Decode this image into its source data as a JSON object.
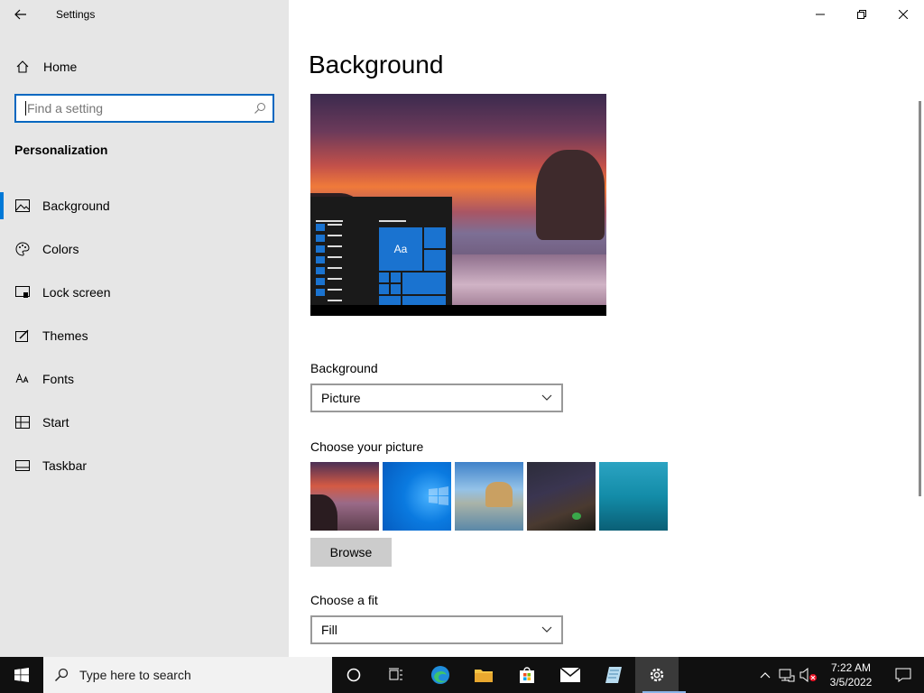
{
  "app": {
    "title": "Settings"
  },
  "sidebar": {
    "home_label": "Home",
    "search_placeholder": "Find a setting",
    "section_title": "Personalization",
    "items": [
      {
        "label": "Background",
        "icon": "picture-icon",
        "active": true
      },
      {
        "label": "Colors",
        "icon": "palette-icon",
        "active": false
      },
      {
        "label": "Lock screen",
        "icon": "lock-screen-icon",
        "active": false
      },
      {
        "label": "Themes",
        "icon": "themes-icon",
        "active": false
      },
      {
        "label": "Fonts",
        "icon": "fonts-icon",
        "active": false
      },
      {
        "label": "Start",
        "icon": "start-icon",
        "active": false
      },
      {
        "label": "Taskbar",
        "icon": "taskbar-icon",
        "active": false
      }
    ]
  },
  "main": {
    "page_title": "Background",
    "preview_tile_text": "Aa",
    "background_label": "Background",
    "background_value": "Picture",
    "choose_picture_label": "Choose your picture",
    "browse_label": "Browse",
    "choose_fit_label": "Choose a fit",
    "fit_value": "Fill"
  },
  "taskbar": {
    "search_placeholder": "Type here to search",
    "time": "7:22 AM",
    "date": "3/5/2022"
  },
  "colors": {
    "accent": "#0078d7",
    "sidebar_bg": "#e6e6e6",
    "taskbar_bg": "#101010"
  }
}
